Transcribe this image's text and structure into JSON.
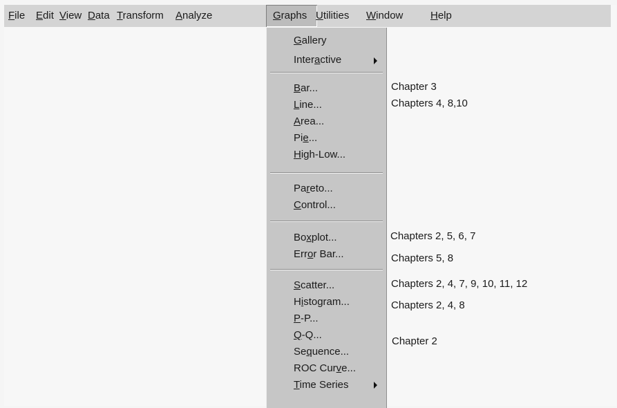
{
  "menubar": {
    "items": [
      {
        "label": "File",
        "mnemonic": "F",
        "rest": "ile"
      },
      {
        "label": "Edit",
        "mnemonic": "E",
        "rest": "dit"
      },
      {
        "label": "View",
        "mnemonic": "V",
        "rest": "iew"
      },
      {
        "label": "Data",
        "mnemonic": "D",
        "rest": "ata"
      },
      {
        "label": "Transform",
        "mnemonic": "T",
        "rest": "ransform"
      },
      {
        "label": "Analyze",
        "mnemonic": "A",
        "rest": "nalyze"
      },
      {
        "label": "Graphs",
        "mnemonic": "G",
        "rest": "raphs",
        "active": true
      },
      {
        "label": "Utilities",
        "mnemonic": "U",
        "rest": "tilities"
      },
      {
        "label": "Window",
        "mnemonic": "W",
        "rest": "indow"
      },
      {
        "label": "Help",
        "mnemonic": "H",
        "rest": "elp"
      }
    ]
  },
  "graphs_menu": {
    "items": [
      {
        "label": "Gallery",
        "pre": "",
        "mnemonic": "G",
        "post": "allery"
      },
      {
        "label": "Interactive",
        "pre": "Inter",
        "mnemonic": "a",
        "post": "ctive",
        "has_submenu": true
      },
      {
        "label": "Bar...",
        "pre": "",
        "mnemonic": "B",
        "post": "ar..."
      },
      {
        "label": "Line...",
        "pre": "",
        "mnemonic": "L",
        "post": "ine..."
      },
      {
        "label": "Area...",
        "pre": "",
        "mnemonic": "A",
        "post": "rea..."
      },
      {
        "label": "Pie...",
        "pre": "Pi",
        "mnemonic": "e",
        "post": "..."
      },
      {
        "label": "High-Low...",
        "pre": "",
        "mnemonic": "H",
        "post": "igh-Low..."
      },
      {
        "label": "Pareto...",
        "pre": "Pa",
        "mnemonic": "r",
        "post": "eto..."
      },
      {
        "label": "Control...",
        "pre": "",
        "mnemonic": "C",
        "post": "ontrol..."
      },
      {
        "label": "Boxplot...",
        "pre": "Bo",
        "mnemonic": "x",
        "post": "plot..."
      },
      {
        "label": "Error Bar...",
        "pre": "Err",
        "mnemonic": "o",
        "post": "r Bar..."
      },
      {
        "label": "Scatter...",
        "pre": "",
        "mnemonic": "S",
        "post": "catter..."
      },
      {
        "label": "Histogram...",
        "pre": "H",
        "mnemonic": "i",
        "post": "stogram..."
      },
      {
        "label": "P-P...",
        "pre": "",
        "mnemonic": "P",
        "post": "-P..."
      },
      {
        "label": "Q-Q...",
        "pre": "",
        "mnemonic": "Q",
        "post": "-Q..."
      },
      {
        "label": "Sequence...",
        "pre": "Se",
        "mnemonic": "q",
        "post": "uence..."
      },
      {
        "label": "ROC Curve...",
        "pre": "ROC Cur",
        "mnemonic": "v",
        "post": "e..."
      },
      {
        "label": "Time Series",
        "pre": "",
        "mnemonic": "T",
        "post": "ime Series",
        "has_submenu": true
      }
    ]
  },
  "annotations": {
    "bar": "Chapter 3",
    "line": "Chapters 4, 8,10",
    "boxplot": "Chapters 2, 5, 6, 7",
    "error_bar": "Chapters 5, 8",
    "scatter": "Chapters 2, 4, 7, 9, 10, 11, 12",
    "histogram": "Chapters 2, 4, 8",
    "qq": "Chapter 2"
  },
  "icons": {
    "submenu": "submenu-arrow-icon"
  },
  "colors": {
    "menubar": "#d4d4d4",
    "dropdown": "#c6c6c6",
    "background": "#f5f5f5"
  }
}
